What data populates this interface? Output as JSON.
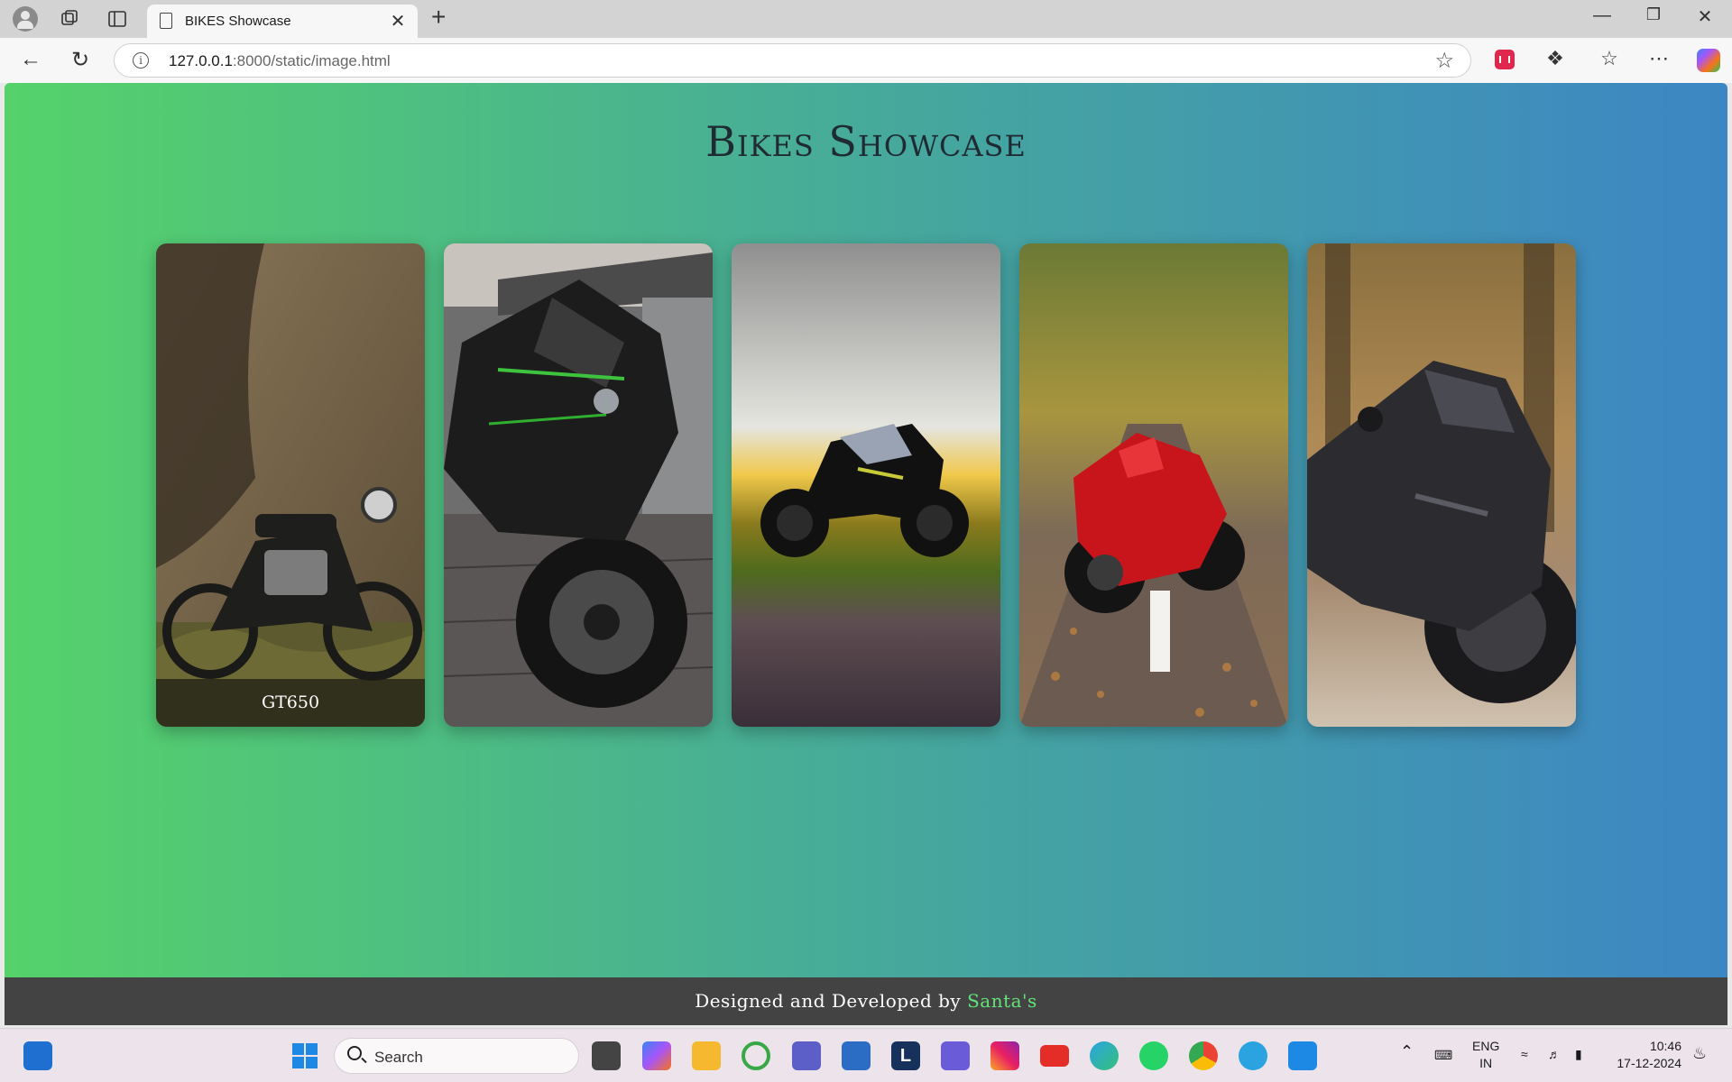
{
  "browser": {
    "tab_title": "BIKES Showcase",
    "new_tab_symbol": "+",
    "close_tab_symbol": "✕",
    "url_host": "127.0.0.1",
    "url_path": ":8000/static/image.html"
  },
  "page": {
    "title": "Bikes Showcase",
    "cards": [
      {
        "caption": "GT650",
        "bike": "royal-enfield-gt650"
      },
      {
        "caption": "",
        "bike": "kawasaki-h2"
      },
      {
        "caption": "",
        "bike": "naked-bike-sunset"
      },
      {
        "caption": "",
        "bike": "ducati-panigale-red"
      },
      {
        "caption": "",
        "bike": "bmw-s1000rr-black"
      }
    ],
    "footer_prefix": "Designed and Developed by",
    "footer_author": "Santa's"
  },
  "taskbar": {
    "search_label": "Search",
    "language": "ENG",
    "region": "IN",
    "time": "10:46",
    "date": "17-12-2024"
  },
  "colors": {
    "gradient_start": "#55d26a",
    "gradient_end": "#3d86c4",
    "footer_bg": "#434343",
    "footer_accent": "#63e27a"
  }
}
